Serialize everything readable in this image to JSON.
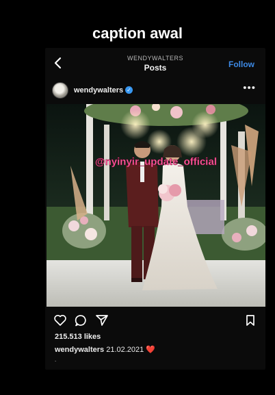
{
  "page": {
    "caption_title": "caption awal"
  },
  "header": {
    "username_small": "WENDYWALTERS",
    "title": "Posts",
    "follow_label": "Follow"
  },
  "post": {
    "username": "wendywalters",
    "watermark": "@nyinyir_update_official",
    "likes": "215.513 likes",
    "caption_user": "wendywalters",
    "caption_text": "21.02.2021",
    "caption_emoji": "❤️",
    "caption_more": "."
  },
  "colors": {
    "background": "#000000",
    "link_blue": "#3d8ae6",
    "verified_blue": "#3897f0",
    "watermark": "#ff5fa0"
  },
  "icons": [
    "back-icon",
    "verified-icon",
    "more-icon",
    "heart-icon",
    "comment-icon",
    "share-icon",
    "bookmark-icon"
  ]
}
